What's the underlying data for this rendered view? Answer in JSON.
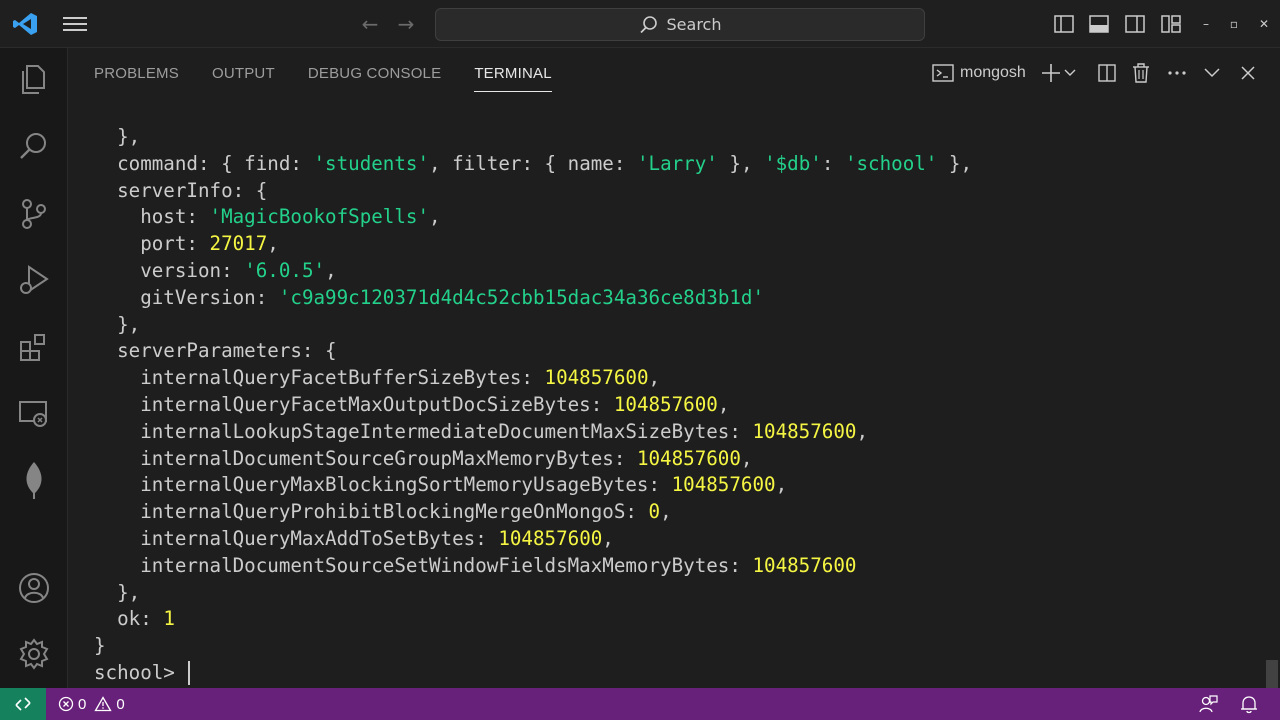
{
  "titlebar": {
    "search_label": "Search",
    "icons": [
      "vscode-logo",
      "menu-icon",
      "back-arrow-icon",
      "forward-arrow-icon",
      "search-icon",
      "toggle-primary-sidebar-icon",
      "toggle-panel-icon",
      "toggle-secondary-sidebar-icon",
      "customize-layout-icon"
    ],
    "window_controls": [
      "minimize",
      "restore",
      "close"
    ]
  },
  "activitybar": {
    "items": [
      "explorer",
      "search",
      "source-control",
      "run-and-debug",
      "extensions",
      "remote-explorer",
      "mongodb"
    ],
    "bottom_items": [
      "accounts",
      "manage"
    ]
  },
  "panel": {
    "tabs": [
      {
        "label": "PROBLEMS",
        "active": false
      },
      {
        "label": "OUTPUT",
        "active": false
      },
      {
        "label": "DEBUG CONSOLE",
        "active": false
      },
      {
        "label": "TERMINAL",
        "active": true
      }
    ],
    "shell_label": "mongosh"
  },
  "terminal": {
    "lines": [
      [
        {
          "t": "  },"
        }
      ],
      [
        {
          "t": "  command: { find: "
        },
        {
          "t": "'students'",
          "c": "s"
        },
        {
          "t": ", filter: { name: "
        },
        {
          "t": "'Larry'",
          "c": "s"
        },
        {
          "t": " }, "
        },
        {
          "t": "'$db'",
          "c": "s"
        },
        {
          "t": ": "
        },
        {
          "t": "'school'",
          "c": "s"
        },
        {
          "t": " },"
        }
      ],
      [
        {
          "t": "  serverInfo: {"
        }
      ],
      [
        {
          "t": "    host: "
        },
        {
          "t": "'MagicBookofSpells'",
          "c": "s"
        },
        {
          "t": ","
        }
      ],
      [
        {
          "t": "    port: "
        },
        {
          "t": "27017",
          "c": "n"
        },
        {
          "t": ","
        }
      ],
      [
        {
          "t": "    version: "
        },
        {
          "t": "'6.0.5'",
          "c": "s"
        },
        {
          "t": ","
        }
      ],
      [
        {
          "t": "    gitVersion: "
        },
        {
          "t": "'c9a99c120371d4d4c52cbb15dac34a36ce8d3b1d'",
          "c": "s"
        }
      ],
      [
        {
          "t": "  },"
        }
      ],
      [
        {
          "t": "  serverParameters: {"
        }
      ],
      [
        {
          "t": "    internalQueryFacetBufferSizeBytes: "
        },
        {
          "t": "104857600",
          "c": "n"
        },
        {
          "t": ","
        }
      ],
      [
        {
          "t": "    internalQueryFacetMaxOutputDocSizeBytes: "
        },
        {
          "t": "104857600",
          "c": "n"
        },
        {
          "t": ","
        }
      ],
      [
        {
          "t": "    internalLookupStageIntermediateDocumentMaxSizeBytes: "
        },
        {
          "t": "104857600",
          "c": "n"
        },
        {
          "t": ","
        }
      ],
      [
        {
          "t": "    internalDocumentSourceGroupMaxMemoryBytes: "
        },
        {
          "t": "104857600",
          "c": "n"
        },
        {
          "t": ","
        }
      ],
      [
        {
          "t": "    internalQueryMaxBlockingSortMemoryUsageBytes: "
        },
        {
          "t": "104857600",
          "c": "n"
        },
        {
          "t": ","
        }
      ],
      [
        {
          "t": "    internalQueryProhibitBlockingMergeOnMongoS: "
        },
        {
          "t": "0",
          "c": "n"
        },
        {
          "t": ","
        }
      ],
      [
        {
          "t": "    internalQueryMaxAddToSetBytes: "
        },
        {
          "t": "104857600",
          "c": "n"
        },
        {
          "t": ","
        }
      ],
      [
        {
          "t": "    internalDocumentSourceSetWindowFieldsMaxMemoryBytes: "
        },
        {
          "t": "104857600",
          "c": "n"
        }
      ],
      [
        {
          "t": "  },"
        }
      ],
      [
        {
          "t": "  ok: "
        },
        {
          "t": "1",
          "c": "n"
        }
      ],
      [
        {
          "t": "}"
        }
      ]
    ],
    "prompt": "school> ",
    "colors": {
      "string": "#23d18b",
      "number": "#f5f543",
      "text": "#cccccc"
    }
  },
  "statusbar": {
    "errors": "0",
    "warnings": "0",
    "background": "#68217a",
    "remote_background": "#16825d"
  }
}
